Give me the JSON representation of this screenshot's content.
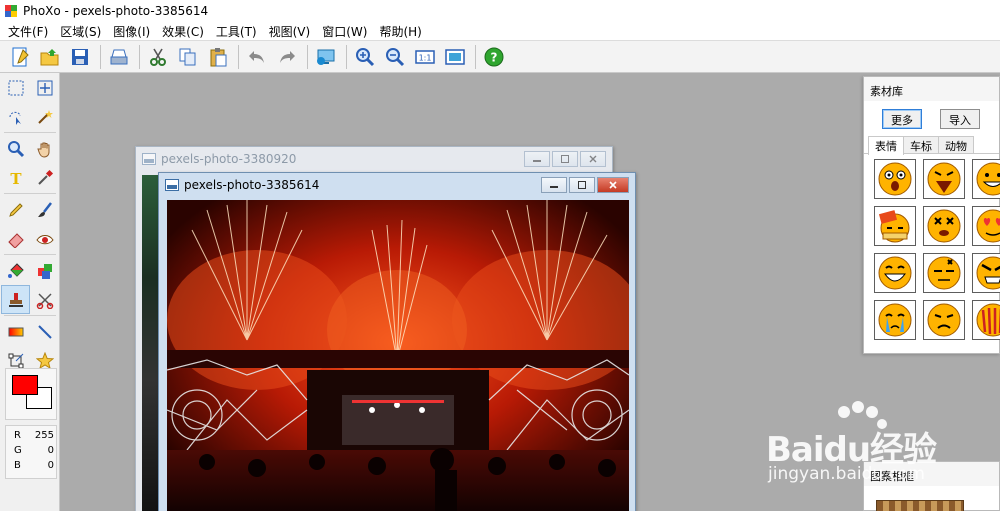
{
  "app": {
    "title": "PhoXo - pexels-photo-3385614"
  },
  "menu": [
    "文件(F)",
    "区域(S)",
    "图像(I)",
    "效果(C)",
    "工具(T)",
    "视图(V)",
    "窗口(W)",
    "帮助(H)"
  ],
  "toolbar": [
    {
      "name": "new-icon",
      "color": "#1f6fd1"
    },
    {
      "name": "open-folder-icon",
      "color": "#e8b21c"
    },
    {
      "name": "save-icon",
      "color": "#2a5fb5"
    },
    {
      "name": "scan-icon",
      "color": "#3a6fbe"
    },
    {
      "name": "cut-icon",
      "color": "#2f7a2f"
    },
    {
      "name": "copy-icon",
      "color": "#3a6fbe"
    },
    {
      "name": "paste-icon",
      "color": "#c99b2a"
    },
    {
      "name": "undo-icon",
      "color": "#7c7c7c"
    },
    {
      "name": "redo-icon",
      "color": "#7c7c7c"
    },
    {
      "name": "screen-capture-icon",
      "color": "#1a8ad0"
    },
    {
      "name": "zoom-in-icon",
      "color": "#2a5fb5"
    },
    {
      "name": "zoom-out-icon",
      "color": "#2a5fb5"
    },
    {
      "name": "actual-size-icon",
      "color": "#2a5fb5"
    },
    {
      "name": "fit-window-icon",
      "color": "#2a5fb5"
    },
    {
      "name": "help-icon",
      "color": "#2fa52f"
    }
  ],
  "tools": [
    "rect-select-icon",
    "move-icon",
    "lasso-select-icon",
    "magic-wand-icon",
    "zoom-tool-icon",
    "hand-tool-icon",
    "text-tool-icon",
    "eyedropper-icon",
    "pencil-icon",
    "brush-icon",
    "eraser-icon",
    "red-eye-icon",
    "fill-icon",
    "color-replace-icon",
    "stamp-icon",
    "warp-icon",
    "gradient-icon",
    "line-icon",
    "transform-icon",
    "star-shape-icon"
  ],
  "colors": {
    "foreground": "#ff0000",
    "background": "#ffffff"
  },
  "rgb": [
    {
      "label": "R",
      "value": "255"
    },
    {
      "label": "G",
      "value": "0"
    },
    {
      "label": "B",
      "value": "0"
    }
  ],
  "windows": {
    "back_title": "pexels-photo-3380920",
    "front_title": "pexels-photo-3385614"
  },
  "library": {
    "title": "素材库",
    "more_label": "更多",
    "import_label": "导入",
    "tabs": [
      "表情",
      "车标",
      "动物"
    ],
    "emojis": [
      "shocked-face-icon",
      "screaming-face-icon",
      "grinning-face-icon",
      "sleeping-face-icon",
      "dizzy-face-icon",
      "heart-eyes-face-icon",
      "laughing-face-icon",
      "angry-vein-face-icon",
      "furious-face-icon",
      "crying-face-icon",
      "frowning-face-icon",
      "ghost-face-icon"
    ]
  },
  "frame_panel": {
    "title": "图案相框"
  },
  "watermark": {
    "logo": "Baidu经验",
    "url": "jingyan.baidu.com"
  }
}
